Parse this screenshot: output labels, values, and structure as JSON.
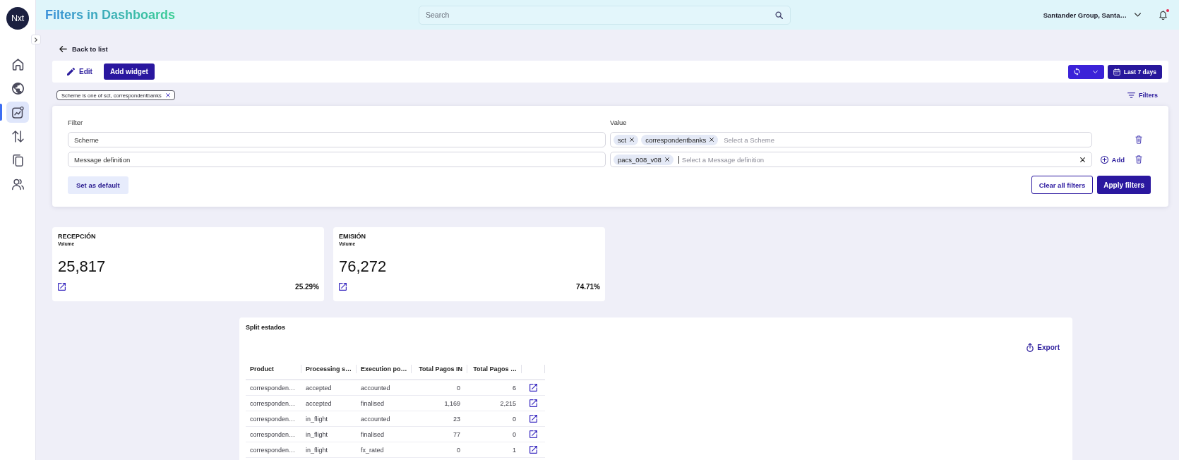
{
  "sidebar": {
    "logo": "Nxt",
    "items": [
      {
        "kind": "home",
        "selected": false
      },
      {
        "kind": "network",
        "selected": false
      },
      {
        "kind": "analytics",
        "selected": true
      },
      {
        "kind": "transfers",
        "selected": false
      },
      {
        "kind": "documents",
        "selected": false
      },
      {
        "kind": "users",
        "selected": false
      }
    ]
  },
  "header": {
    "title": "Filters in Dashboards",
    "search": {
      "placeholder": "Search"
    },
    "account": "Santander Group, Santa…",
    "notification_dot": true
  },
  "back_link": "Back to list",
  "toolbar": {
    "edit": "Edit",
    "add_widget": "Add widget",
    "date_range": "Last 7 days"
  },
  "active_filters": [
    "Scheme is one of sct, correspondentbanks"
  ],
  "filters_toggle": "Filters",
  "filter_panel": {
    "filter_heading": "Filter",
    "value_heading": "Value",
    "rows": [
      {
        "filter": "Scheme",
        "values": [
          "sct",
          "correspondentbanks"
        ],
        "placeholder": "Select a Scheme",
        "focused": false
      },
      {
        "filter": "Message definition",
        "values": [
          "pacs_008_v08"
        ],
        "placeholder": "Select a Message definition",
        "focused": true,
        "add": "Add"
      }
    ],
    "set_default": "Set as default",
    "clear": "Clear all filters",
    "apply": "Apply filters"
  },
  "cards": [
    {
      "title": "RECEPCIÓN",
      "subtitle": "Volume",
      "value": "25,817",
      "share": "25.29%"
    },
    {
      "title": "EMISIÓN",
      "subtitle": "Volume",
      "value": "76,272",
      "share": "74.71%"
    }
  ],
  "table_widget": {
    "title": "Split estados",
    "export": "Export",
    "columns": [
      "Product",
      "Processing s…",
      "Execution po…",
      "Total Pagos IN",
      "Total Pagos …"
    ],
    "rows": [
      [
        "corresponden…",
        "accepted",
        "accounted",
        "0",
        "6"
      ],
      [
        "corresponden…",
        "accepted",
        "finalised",
        "1,169",
        "2,215"
      ],
      [
        "corresponden…",
        "in_flight",
        "accounted",
        "23",
        "0"
      ],
      [
        "corresponden…",
        "in_flight",
        "finalised",
        "77",
        "0"
      ],
      [
        "corresponden…",
        "in_flight",
        "fx_rated",
        "0",
        "1"
      ]
    ]
  }
}
